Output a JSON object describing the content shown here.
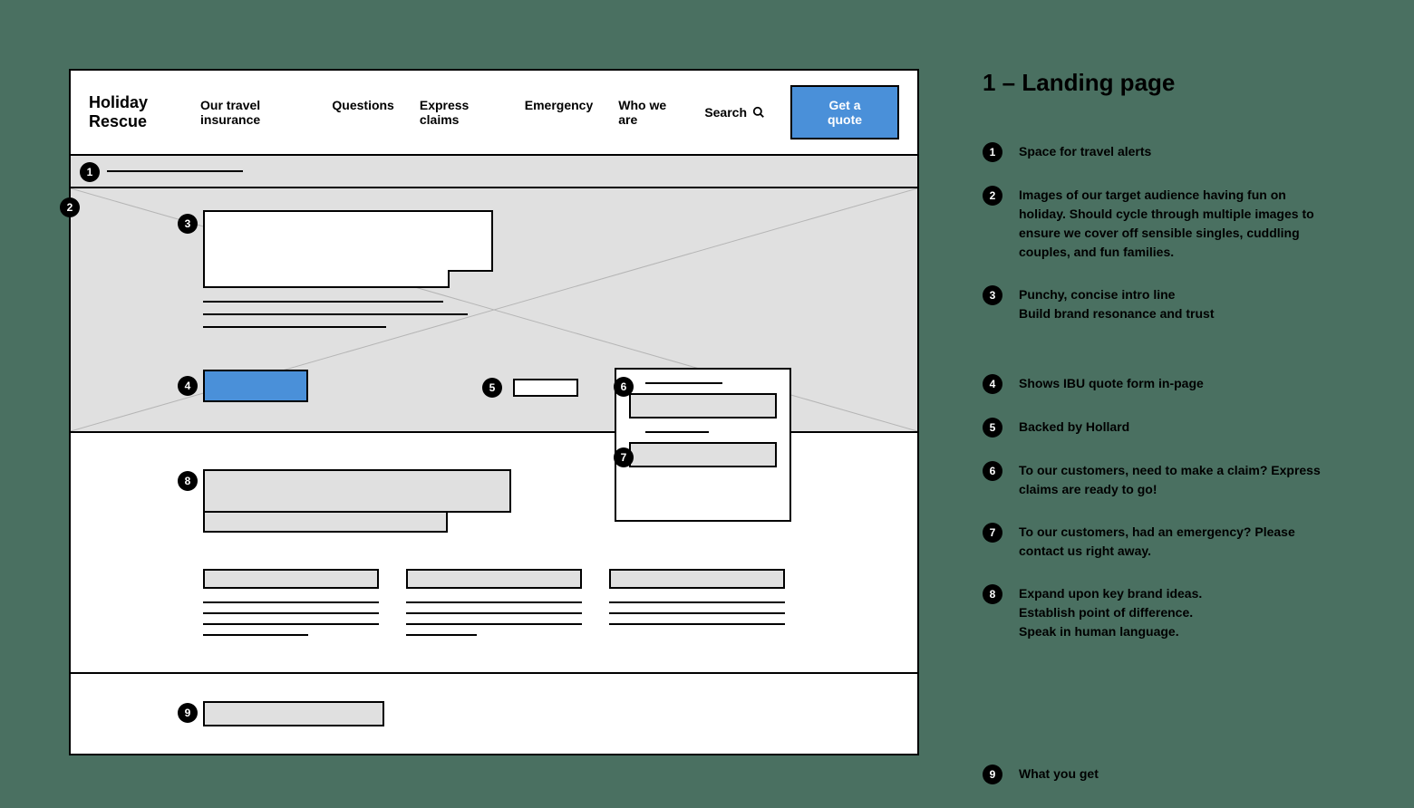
{
  "brand": {
    "line1": "Holiday",
    "line2": "Rescue"
  },
  "nav": {
    "item1": "Our travel insurance",
    "item2": "Questions",
    "item3": "Express claims",
    "item4": "Emergency",
    "item5": "Who we are",
    "search": "Search"
  },
  "cta": {
    "quote": "Get a quote"
  },
  "annotations": {
    "title": "1 – Landing page",
    "items": [
      {
        "n": "1",
        "text": "Space for travel alerts"
      },
      {
        "n": "2",
        "text": "Images of our target audience having fun on holiday. Should cycle through multiple images to ensure we cover off sensible singles, cuddling couples, and fun families."
      },
      {
        "n": "3",
        "text": "Punchy, concise intro line\nBuild brand resonance and trust"
      },
      {
        "n": "4",
        "text": "Shows IBU quote form in-page"
      },
      {
        "n": "5",
        "text": "Backed by Hollard"
      },
      {
        "n": "6",
        "text": "To our customers, need to make a claim? Express claims are ready to go!"
      },
      {
        "n": "7",
        "text": "To our customers, had an emergency? Please contact us right away."
      },
      {
        "n": "8",
        "text": "Expand upon key brand ideas.\nEstablish point of difference.\nSpeak in human language."
      },
      {
        "n": "9",
        "text": "What you get"
      }
    ]
  },
  "markers": {
    "m1": "1",
    "m2": "2",
    "m3": "3",
    "m4": "4",
    "m5": "5",
    "m6": "6",
    "m7": "7",
    "m8": "8",
    "m9": "9"
  }
}
